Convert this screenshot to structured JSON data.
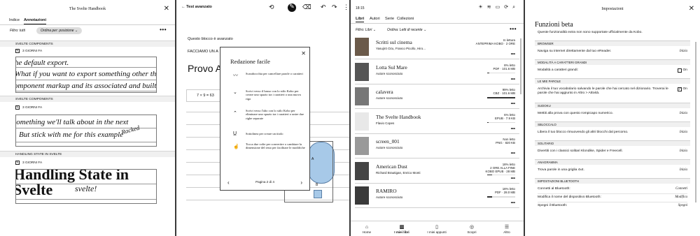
{
  "panel1": {
    "title": "The Svelte Handbook",
    "tabs": [
      "Indice",
      "Annotazioni"
    ],
    "filter": "Filtro: tutti",
    "order": "Ordina per: posizione",
    "sections": [
      {
        "header": "SVELTE COMPONENTS",
        "meta": "3 GIORNI FA",
        "hw": [
          "he default export.",
          "What if you want to export something other than",
          "component markup and its associated and built-in"
        ]
      },
      {
        "header": "SVELTE COMPONENTS",
        "meta": "3 GIORNI FA",
        "hw": [
          "something we'll talk about in the next",
          "But stick with me for this example",
          "Racked"
        ]
      },
      {
        "header": "HANDLING STATE IN SVELTE",
        "meta": "3 GIORNI FA",
        "hw": [
          "Handling State in",
          "Svelte",
          "svelte!"
        ]
      }
    ]
  },
  "panel2": {
    "back_label": "Test avanzato",
    "note1": "Questo blocco è avanzato",
    "note2": "FACCIAMO UN A",
    "heading": "Provo A",
    "math": "7 × 9 = 63",
    "popup": {
      "title": "Redazione facile",
      "items": [
        {
          "icon": "scribble-icon",
          "glyph": "〰",
          "text": "Scarabocchia per cancellare parole o caratteri"
        },
        {
          "icon": "caret-down-icon",
          "glyph": "⌄",
          "text": "Scrivi verso il basso con lo stilo Kobo per creare uno spazio tra i caratteri o una nuova riga"
        },
        {
          "icon": "caret-up-icon",
          "glyph": "⌃",
          "text": "Scrivi verso l'alto con lo stilo Kobo per eliminare uno spazio tra i caratteri o unire due righe separate"
        },
        {
          "icon": "underline-icon",
          "glyph": "U̲",
          "text": "Sottolinea per creare un titolo"
        },
        {
          "icon": "hand-tap-icon",
          "glyph": "☝",
          "text": "Tocca due volte per convertire o cambiare la dimensione del testo per facilitare le modifiche"
        }
      ],
      "page": "Pagina 2 di 4"
    },
    "diagram_labels": [
      "A",
      "B"
    ]
  },
  "panel3": {
    "time": "18:15",
    "tabs": [
      "Libri",
      "Autori",
      "Serie",
      "Collezioni"
    ],
    "filter": "Filtro: Libri",
    "order": "Ordina: Letti di recente",
    "books": [
      {
        "title": "Scritti sul cinema",
        "author": "Yasujirō Ozu, Franco Picollo, Hiro...",
        "right": [
          "In lettura",
          "ANTEPRIMA KOBO · 2 ORE"
        ],
        "progress": null,
        "cover": "#6b5a4a"
      },
      {
        "title": "Lotta Sul Mare",
        "author": "Autore sconosciuto",
        "right": [
          "8% letto",
          "PDF · 101.6 MB"
        ],
        "progress": 8,
        "cover": "#555"
      },
      {
        "title": "calavera",
        "author": "Autore sconosciuto",
        "right": [
          "99% letto",
          "CBZ · 101.6 MB"
        ],
        "progress": 99,
        "cover": "#777"
      },
      {
        "title": "The Svelte Handbook",
        "author": "Flavio Copes",
        "right": [
          "6% letto",
          "EPUB · 7.9 KB"
        ],
        "progress": 6,
        "cover": "#e8e8e8"
      },
      {
        "title": "screen_001",
        "author": "Autore sconosciuto",
        "right": [
          "Non letto",
          "PNG · 820 KB"
        ],
        "progress": 0,
        "cover": "#999"
      },
      {
        "title": "American Dust",
        "author": "Richard Brautigan, Enrico Monti",
        "right": [
          "18% letto",
          "2 ORE ALLA FINE",
          "KOBO EPUB · 28 MB"
        ],
        "progress": 18,
        "cover": "#444"
      },
      {
        "title": "RAMIRO",
        "author": "Autore sconosciuto",
        "right": [
          "18% letto",
          "PDF · 28.0 MB"
        ],
        "progress": 18,
        "cover": "#3a3a3a"
      }
    ],
    "nav": [
      {
        "label": "Home",
        "glyph": "⌂"
      },
      {
        "label": "I miei libri",
        "glyph": "▥"
      },
      {
        "label": "I miei appunti",
        "glyph": "▯"
      },
      {
        "label": "Scopri",
        "glyph": "◎"
      },
      {
        "label": "Altro",
        "glyph": "☰"
      }
    ]
  },
  "panel4": {
    "title": "Impostazioni",
    "heading": "Funzioni beta",
    "subheading": "Queste funzionalità extra non sono supportate ufficialmente da Kobo.",
    "sections": [
      {
        "header": "BROWSER",
        "rows": [
          {
            "text": "Naviga su internet direttamente dal tuo eReader.",
            "value": "Inizia"
          }
        ]
      },
      {
        "header": "MODALITÀ A CARATTERI GRANDI",
        "rows": [
          {
            "text": "Modalità a caratteri grandi:",
            "value": "On",
            "checkbox": false
          }
        ]
      },
      {
        "header": "LE MIE PAROLE",
        "rows": [
          {
            "text": "Archivia il tuo vocabolario salvando le parole che hai cercato nel dizionario. Troverai le parole che hai aggiunto in Altro > Attività.",
            "value": "On",
            "checkbox": true
          }
        ]
      },
      {
        "header": "SUDOKU",
        "rows": [
          {
            "text": "Mettiti alla prova con questo rompicapo numerico.",
            "value": "Inizia"
          }
        ]
      },
      {
        "header": "SBLOCCALO",
        "rows": [
          {
            "text": "Libera il tuo blocco rimuovendo gli altri blocchi dal percorso.",
            "value": "Inizia"
          }
        ]
      },
      {
        "header": "SOLITARIO",
        "rows": [
          {
            "text": "Divertiti con i classici solitari Klondike, Spider e Freecell.",
            "value": "Inizia"
          }
        ]
      },
      {
        "header": "ANAGRAMMA",
        "rows": [
          {
            "text": "Trova parole in una griglia 4x4.",
            "value": "Inizia"
          }
        ]
      },
      {
        "header": "IMPOSTAZIONI BLUETOOTH",
        "rows": [
          {
            "text": "Connetti al Bluetooth:",
            "value": "Connetti"
          },
          {
            "text": "Modifica il nome del dispositivo Bluetooth:",
            "value": "Modifica"
          },
          {
            "text": "Spegni il Bluetooth:",
            "value": "Spegni"
          }
        ]
      }
    ]
  }
}
